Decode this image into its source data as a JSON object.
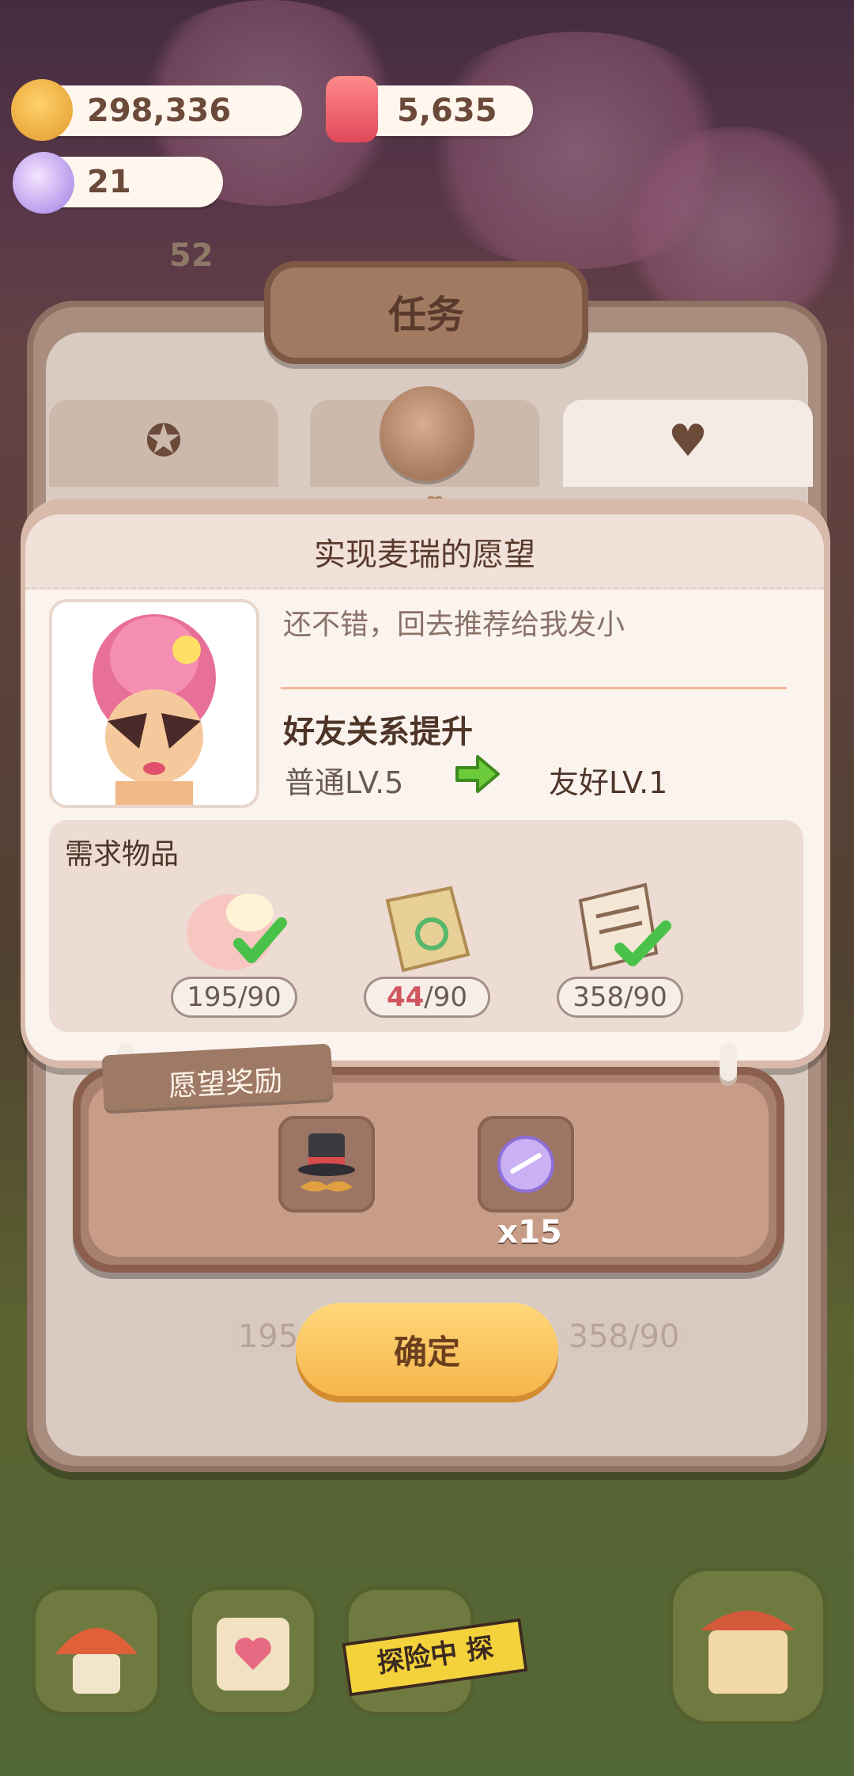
{
  "currencies": {
    "coins": {
      "value": "298,336",
      "icon": "cookie-coin-icon"
    },
    "candles": {
      "value": "5,635",
      "icon": "candle-icon"
    },
    "candy": {
      "value": "21",
      "icon": "candy-icon"
    }
  },
  "hud": {
    "badge_count": "52"
  },
  "panel": {
    "title": "任务",
    "tabs": [
      {
        "icon": "paw-badge-icon",
        "active": false
      },
      {
        "icon": "blank-tab",
        "active": false
      },
      {
        "icon": "heart-flask-icon",
        "active": true
      }
    ]
  },
  "wish": {
    "title": "实现麦瑞的愿望",
    "dialog": "还不错，回去推荐给我发小",
    "friendship_title": "好友关系提升",
    "level_from": "普通LV.5",
    "level_to": "友好LV.1",
    "requirements_label": "需求物品",
    "requirements": [
      {
        "name": "cream-bun-icon",
        "have": "195",
        "need": "/90",
        "complete": true
      },
      {
        "name": "paper-bag-icon",
        "have": "44",
        "need": "/90",
        "complete": false
      },
      {
        "name": "newspaper-icon",
        "have": "358",
        "need": "/90",
        "complete": true
      }
    ]
  },
  "reward": {
    "label": "愿望奖励",
    "items": [
      {
        "name": "top-hat-mustache-icon",
        "qty": ""
      },
      {
        "name": "candy-icon",
        "qty": "x15"
      }
    ]
  },
  "background_counts": [
    "195",
    "358/90"
  ],
  "confirm_label": "确定",
  "dock": {
    "explore_label": "探险中 探"
  },
  "colors": {
    "accent": "#f6b64c",
    "warning": "#d1555f",
    "panel": "#fbf3ee",
    "wood": "#a98070"
  }
}
